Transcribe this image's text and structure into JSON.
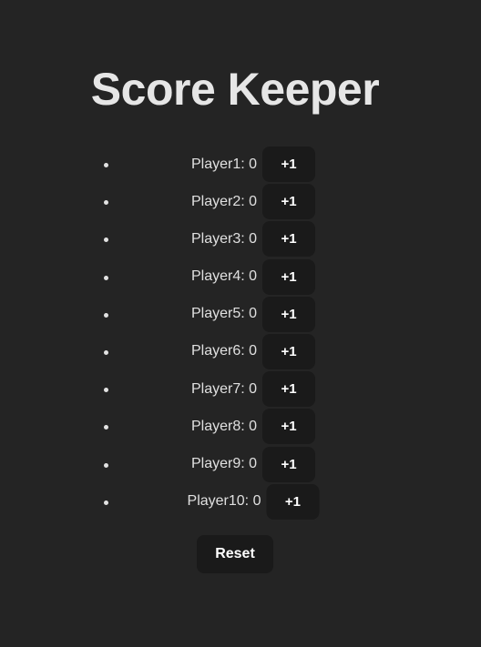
{
  "app": {
    "title": "Score Keeper"
  },
  "players": [
    {
      "name": "Player1",
      "score": 0
    },
    {
      "name": "Player2",
      "score": 0
    },
    {
      "name": "Player3",
      "score": 0
    },
    {
      "name": "Player4",
      "score": 0
    },
    {
      "name": "Player5",
      "score": 0
    },
    {
      "name": "Player6",
      "score": 0
    },
    {
      "name": "Player7",
      "score": 0
    },
    {
      "name": "Player8",
      "score": 0
    },
    {
      "name": "Player9",
      "score": 0
    },
    {
      "name": "Player10",
      "score": 0
    }
  ],
  "controls": {
    "increment_label": "+1",
    "reset_label": "Reset"
  },
  "colors": {
    "background": "#242424",
    "button_background": "#1a1a1a",
    "text": "#e0e0e0"
  }
}
